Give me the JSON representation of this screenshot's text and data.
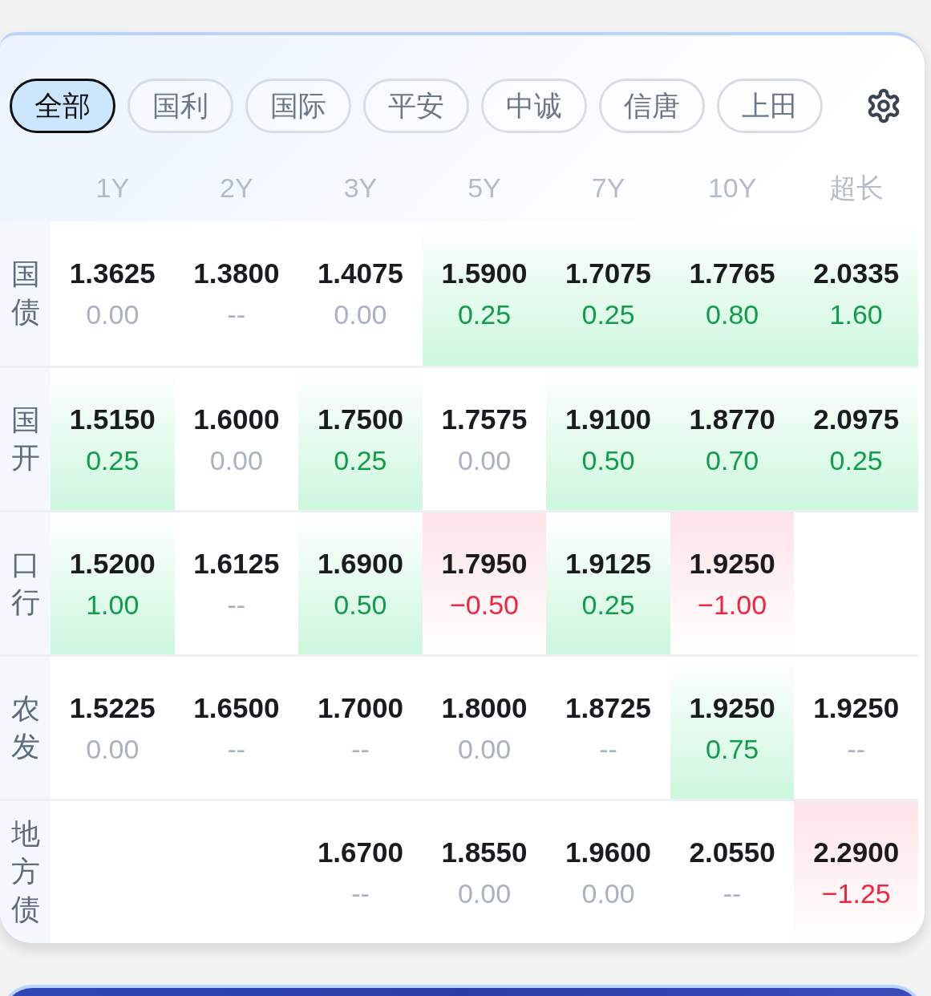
{
  "filters": [
    {
      "label": "全部",
      "selected": true
    },
    {
      "label": "国利",
      "selected": false
    },
    {
      "label": "国际",
      "selected": false
    },
    {
      "label": "平安",
      "selected": false
    },
    {
      "label": "中诚",
      "selected": false
    },
    {
      "label": "信唐",
      "selected": false
    },
    {
      "label": "上田",
      "selected": false
    }
  ],
  "columns": [
    "1Y",
    "2Y",
    "3Y",
    "5Y",
    "7Y",
    "10Y",
    "超长"
  ],
  "rows": [
    {
      "label": "国债",
      "cells": [
        {
          "kind": "quote",
          "rate": "1.3625",
          "change": "0.00",
          "color": "#a9b2c3"
        },
        {
          "kind": "quote",
          "rate": "1.3800",
          "change": "--",
          "color": "#a9b2c3"
        },
        {
          "kind": "quote",
          "rate": "1.4075",
          "change": "0.00",
          "color": "#a9b2c3"
        },
        {
          "kind": "quote",
          "rate": "1.5900",
          "change": "0.25",
          "color": "#0f9d4b"
        },
        {
          "kind": "quote",
          "rate": "1.7075",
          "change": "0.25",
          "color": "#0f9d4b"
        },
        {
          "kind": "quote",
          "rate": "1.7765",
          "change": "0.80",
          "color": "#0f9d4b"
        },
        {
          "kind": "quote",
          "rate": "2.0335",
          "change": "1.60",
          "color": "#0f9d4b"
        }
      ]
    },
    {
      "label": "国开",
      "cells": [
        {
          "kind": "quote",
          "rate": "1.5150",
          "change": "0.25",
          "color": "#0f9d4b"
        },
        {
          "kind": "quote",
          "rate": "1.6000",
          "change": "0.00",
          "color": "#a9b2c3"
        },
        {
          "kind": "quote",
          "rate": "1.7500",
          "change": "0.25",
          "color": "#0f9d4b"
        },
        {
          "kind": "quote",
          "rate": "1.7575",
          "change": "0.00",
          "color": "#a9b2c3"
        },
        {
          "kind": "quote",
          "rate": "1.9100",
          "change": "0.50",
          "color": "#0f9d4b"
        },
        {
          "kind": "quote",
          "rate": "1.8770",
          "change": "0.70",
          "color": "#0f9d4b"
        },
        {
          "kind": "quote",
          "rate": "2.0975",
          "change": "0.25",
          "color": "#0f9d4b"
        }
      ]
    },
    {
      "label": "口行",
      "cells": [
        {
          "kind": "quote",
          "rate": "1.5200",
          "change": "1.00",
          "color": "#0f9d4b"
        },
        {
          "kind": "quote",
          "rate": "1.6125",
          "change": "--",
          "color": "#a9b2c3"
        },
        {
          "kind": "quote",
          "rate": "1.6900",
          "change": "0.50",
          "color": "#0f9d4b"
        },
        {
          "kind": "quote",
          "rate": "1.7950",
          "change": "−0.50",
          "color": "#f0243f"
        },
        {
          "kind": "quote",
          "rate": "1.9125",
          "change": "0.25",
          "color": "#0f9d4b"
        },
        {
          "kind": "quote",
          "rate": "1.9250",
          "change": "−1.00",
          "color": "#f0243f"
        },
        {
          "kind": "empty"
        }
      ]
    },
    {
      "label": "农发",
      "cells": [
        {
          "kind": "quote",
          "rate": "1.5225",
          "change": "0.00",
          "color": "#a9b2c3"
        },
        {
          "kind": "quote",
          "rate": "1.6500",
          "change": "--",
          "color": "#a9b2c3"
        },
        {
          "kind": "quote",
          "rate": "1.7000",
          "change": "--",
          "color": "#a9b2c3"
        },
        {
          "kind": "quote",
          "rate": "1.8000",
          "change": "0.00",
          "color": "#a9b2c3"
        },
        {
          "kind": "quote",
          "rate": "1.8725",
          "change": "--",
          "color": "#a9b2c3"
        },
        {
          "kind": "quote",
          "rate": "1.9250",
          "change": "0.75",
          "color": "#0f9d4b"
        },
        {
          "kind": "quote",
          "rate": "1.9250",
          "change": "--",
          "color": "#a9b2c3"
        }
      ]
    },
    {
      "label": "地方债",
      "cells": [
        {
          "kind": "empty"
        },
        {
          "kind": "empty"
        },
        {
          "kind": "quote",
          "rate": "1.6700",
          "change": "--",
          "color": "#a9b2c3"
        },
        {
          "kind": "quote",
          "rate": "1.8550",
          "change": "0.00",
          "color": "#a9b2c3"
        },
        {
          "kind": "quote",
          "rate": "1.9600",
          "change": "0.00",
          "color": "#a9b2c3"
        },
        {
          "kind": "quote",
          "rate": "2.0550",
          "change": "--",
          "color": "#a9b2c3"
        },
        {
          "kind": "quote",
          "rate": "2.2900",
          "change": "−1.25",
          "color": "#f0243f"
        }
      ]
    }
  ]
}
